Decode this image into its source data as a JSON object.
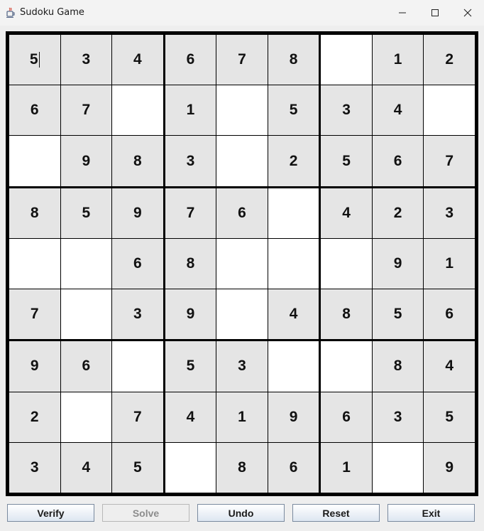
{
  "window": {
    "title": "Sudoku Game",
    "icon": "java-cup-icon",
    "controls": [
      "minimize-icon",
      "maximize-icon",
      "close-icon"
    ]
  },
  "board": {
    "size": 9,
    "selected_cell": [
      0,
      0
    ],
    "grid": [
      [
        "5",
        "3",
        "4",
        "6",
        "7",
        "8",
        "",
        "1",
        "2"
      ],
      [
        "6",
        "7",
        "",
        "1",
        "",
        "5",
        "3",
        "4",
        ""
      ],
      [
        "",
        "9",
        "8",
        "3",
        "",
        "2",
        "5",
        "6",
        "7"
      ],
      [
        "8",
        "5",
        "9",
        "7",
        "6",
        "",
        "4",
        "2",
        "3"
      ],
      [
        "",
        "",
        "6",
        "8",
        "",
        "",
        "",
        "9",
        "1"
      ],
      [
        "7",
        "",
        "3",
        "9",
        "",
        "4",
        "8",
        "5",
        "6"
      ],
      [
        "9",
        "6",
        "",
        "5",
        "3",
        "",
        "",
        "8",
        "4"
      ],
      [
        "2",
        "",
        "7",
        "4",
        "1",
        "9",
        "6",
        "3",
        "5"
      ],
      [
        "3",
        "4",
        "5",
        "",
        "8",
        "6",
        "1",
        "",
        "9"
      ]
    ],
    "colors": {
      "given_bg": "#e5e5e5",
      "empty_bg": "#ffffff",
      "grid_line": "#000000"
    }
  },
  "buttons": [
    {
      "name": "verify-button",
      "label": "Verify",
      "enabled": true
    },
    {
      "name": "solve-button",
      "label": "Solve",
      "enabled": false
    },
    {
      "name": "undo-button",
      "label": "Undo",
      "enabled": true
    },
    {
      "name": "reset-button",
      "label": "Reset",
      "enabled": true
    },
    {
      "name": "exit-button",
      "label": "Exit",
      "enabled": true
    }
  ]
}
